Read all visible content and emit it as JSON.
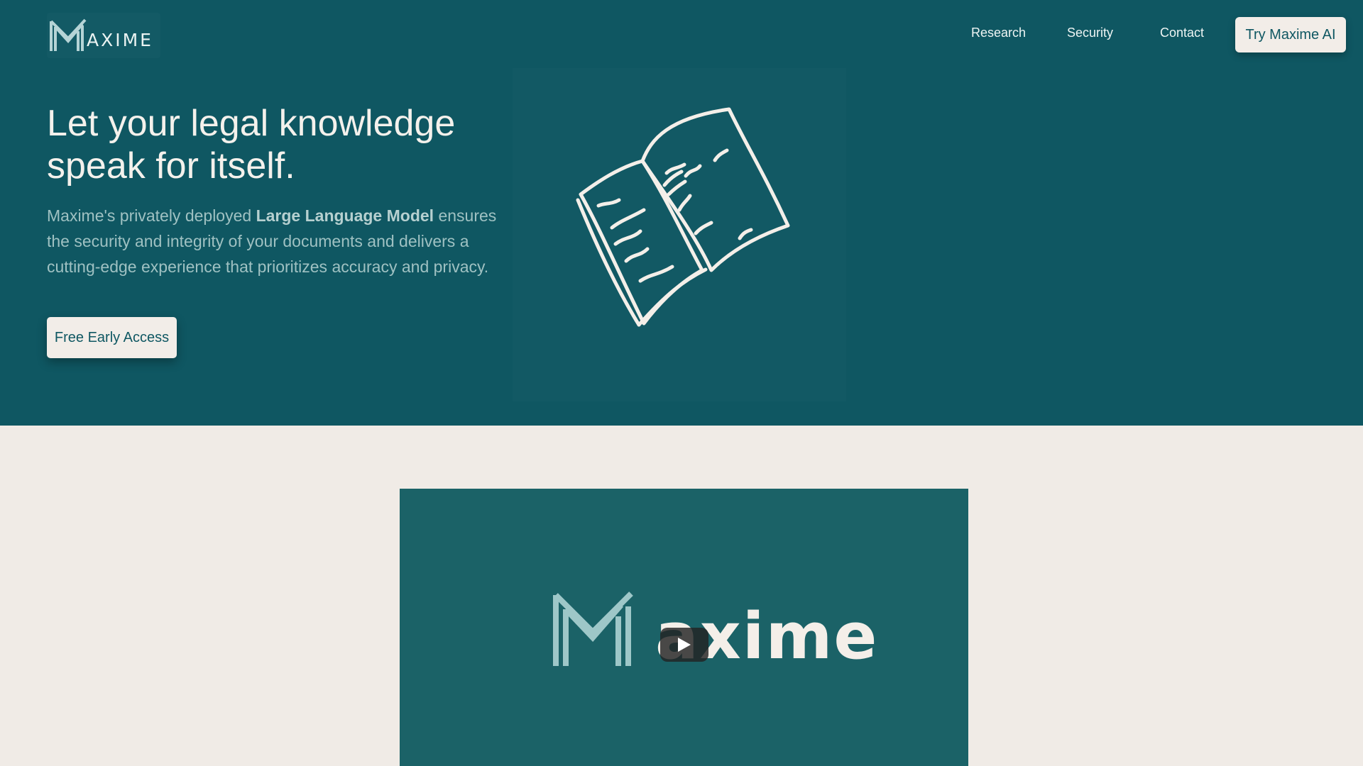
{
  "header": {
    "logo_text": "AXIME",
    "nav": [
      "Research",
      "Security",
      "Contact"
    ],
    "cta_label": "Try Maxime AI"
  },
  "hero": {
    "headline": "Let your legal knowledge speak for itself.",
    "sub_pre": "Maxime's privately deployed ",
    "sub_bold": "Large Language Model",
    "sub_post": " ensures the security and integrity of your documents and delivers a cutting-edge experience that prioritizes accuracy and privacy.",
    "cta_label": "Free Early Access",
    "illustration_icon": "open-book-icon"
  },
  "video": {
    "logo_word": "axime",
    "play_icon": "play-icon"
  },
  "colors": {
    "hero_bg": "#0f5762",
    "page_bg": "#f0ebe6",
    "video_bg": "#1b6267",
    "button_bg": "#f2ede8",
    "accent_text": "#0f5762"
  }
}
